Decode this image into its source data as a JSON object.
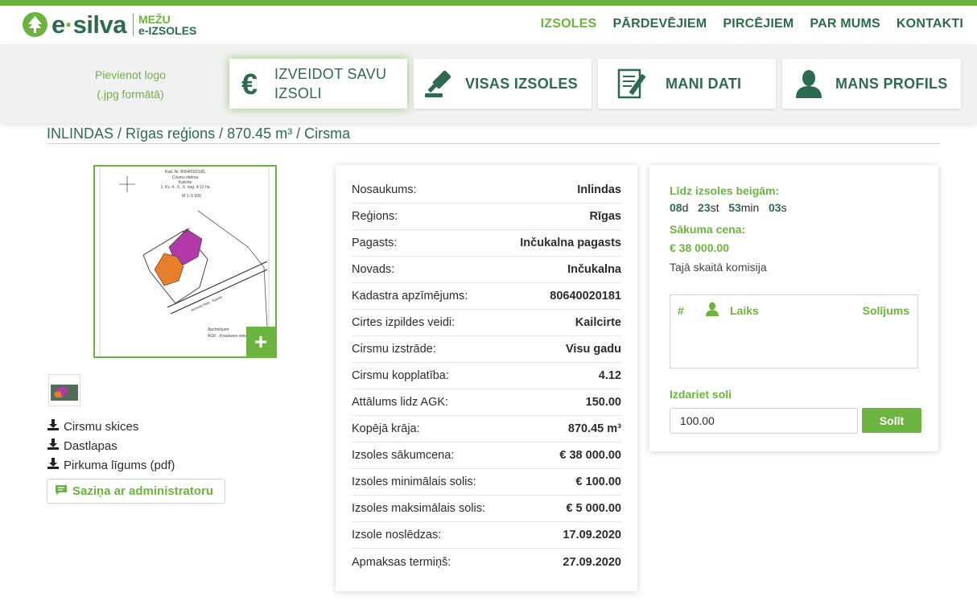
{
  "header": {
    "logo_main": "e·silva",
    "logo_main_a": "e",
    "logo_main_dot": "·",
    "logo_main_b": "silva",
    "logo_sub1": "MEŽU",
    "logo_sub2": "e-IZSOLES",
    "nav": [
      {
        "label": "IZSOLES",
        "active": true
      },
      {
        "label": "PĀRDEVĒJIEM",
        "active": false
      },
      {
        "label": "PIRCĒJIEM",
        "active": false
      },
      {
        "label": "PAR MUMS",
        "active": false
      },
      {
        "label": "KONTAKTI",
        "active": false
      }
    ],
    "accent_color": "#6db33f",
    "brand_color": "#2d6a4f"
  },
  "actions": {
    "add_logo_line1": "Pievienot logo",
    "add_logo_line2": "(.jpg formātā)",
    "tiles": [
      {
        "label1": "IZVEIDOT SAVU",
        "label2": "IZSOLI",
        "icon": "euro-icon"
      },
      {
        "label": "VISAS IZSOLES",
        "icon": "gavel-icon"
      },
      {
        "label": "MANI DATI",
        "icon": "document-edit-icon"
      },
      {
        "label": "MANS PROFILS",
        "icon": "user-icon"
      }
    ]
  },
  "breadcrumb": "INLINDAS / Rīgas reģions / 870.45 m³ / Cirsma",
  "map": {
    "cad_no": "Kad. Nr. 80640020181",
    "title": "Cirsmu shēma",
    "place": "Kalcirte",
    "plots": "1. Kv. 4., 5., 6. nog. 4.12 ha",
    "scale": "M 1: 5 000",
    "agk": "AGK",
    "road": "Autoceļš Rīga - Sigulda",
    "legend1": "Apzīmējumi:",
    "legend2": "AGK - Krautuves vieta"
  },
  "files": [
    "Cirsmu skices",
    "Dastlapas",
    "Pirkuma līgums (pdf)"
  ],
  "admin_button": "Saziņa ar administratoru",
  "details": [
    {
      "k": "Nosaukums:",
      "v": "Inlindas"
    },
    {
      "k": "Reģions:",
      "v": "Rīgas"
    },
    {
      "k": "Pagasts:",
      "v": "Inčukalna pagasts"
    },
    {
      "k": "Novads:",
      "v": "Inčukalna"
    },
    {
      "k": "Kadastra apzīmējums:",
      "v": "80640020181"
    },
    {
      "k": "Cirtes izpildes veidi:",
      "v": "Kailcirte"
    },
    {
      "k": "Cirsmu izstrāde:",
      "v": "Visu gadu"
    },
    {
      "k": "Cirsmu kopplatība:",
      "v": "4.12"
    },
    {
      "k": "Attālums lidz AGK:",
      "v": "150.00"
    },
    {
      "k": "Kopējā krāja:",
      "v": "870.45 m³"
    },
    {
      "k": "Izsoles sākumcena:",
      "v": "€ 38 000.00"
    },
    {
      "k": "Izsoles minimālais solis:",
      "v": "€ 100.00"
    },
    {
      "k": "Izsoles maksimālais solis:",
      "v": "€ 5 000.00"
    },
    {
      "k": "Izsole noslēdzas:",
      "v": "17.09.2020"
    },
    {
      "k": "Apmaksas termiņš:",
      "v": "27.09.2020"
    }
  ],
  "bid": {
    "countdown_label": "Līdz izsoles beigām:",
    "days": "08",
    "days_unit": "d",
    "hours": "23",
    "hours_unit": "st",
    "minutes": "53",
    "minutes_unit": "min",
    "seconds": "03",
    "seconds_unit": "s",
    "price_label": "Sākuma cena:",
    "price": "€ 38 000.00",
    "commission": "Tajā skaitā komisija",
    "table_headers": {
      "num": "#",
      "time": "Laiks",
      "steps": "Solījums"
    },
    "step_label": "Izdariet soli",
    "step_value": "100.00",
    "submit": "Solīt"
  }
}
